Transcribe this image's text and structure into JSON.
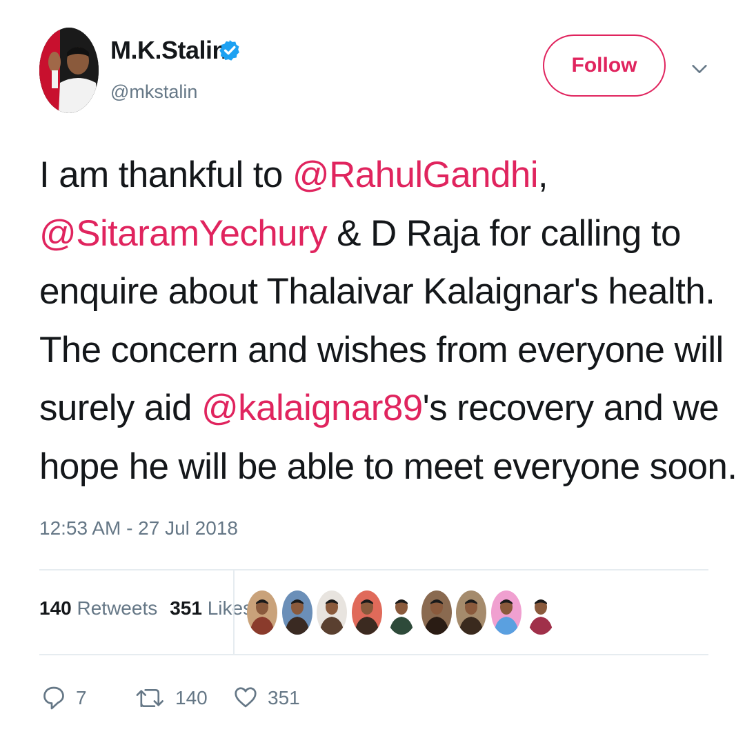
{
  "user": {
    "display_name": "M.K.Stalin",
    "handle": "@mkstalin",
    "verified": true
  },
  "follow_label": "Follow",
  "tweet": {
    "lines": [
      [
        {
          "t": "I am thankful to "
        },
        {
          "t": "@RahulGandhi",
          "mention": true
        },
        {
          "t": ","
        }
      ],
      [
        {
          "t": "@SitaramYechury",
          "mention": true
        },
        {
          "t": " & D Raja for calling to"
        }
      ],
      [
        {
          "t": "enquire about Thalaivar Kalaignar's health."
        }
      ],
      [
        {
          "t": "The concern and wishes from everyone will"
        }
      ],
      [
        {
          "t": "surely aid "
        },
        {
          "t": "@kalaignar89",
          "mention": true
        },
        {
          "t": "'s recovery and we"
        }
      ],
      [
        {
          "t": "hope he will be able to meet everyone soon."
        }
      ]
    ],
    "timestamp": "12:53 AM - 27 Jul 2018"
  },
  "stats": {
    "retweets_count": "140",
    "retweets_label": "Retweets",
    "likes_count": "351",
    "likes_label": "Likes"
  },
  "liker_avatars": [
    {
      "name": "liker-avatar-1",
      "bg": "#c9a27a",
      "fg": "#8a3b2c"
    },
    {
      "name": "liker-avatar-2",
      "bg": "#6b8fb8",
      "fg": "#3a2a22"
    },
    {
      "name": "liker-avatar-3",
      "bg": "#e8e4df",
      "fg": "#5a4030"
    },
    {
      "name": "liker-avatar-4",
      "bg": "#e06a5a",
      "fg": "#3b2a20"
    },
    {
      "name": "liker-avatar-5",
      "bg": "#ffffff",
      "fg": "#2e4a3a"
    },
    {
      "name": "liker-avatar-6",
      "bg": "#8a6a50",
      "fg": "#2a1c14"
    },
    {
      "name": "liker-avatar-7",
      "bg": "#a58b6c",
      "fg": "#3a2a1e"
    },
    {
      "name": "liker-avatar-8",
      "bg": "#f0a0d0",
      "fg": "#5aa0e0"
    },
    {
      "name": "liker-avatar-9",
      "bg": "#ffffff",
      "fg": "#a0304a"
    }
  ],
  "actions": {
    "reply_count": "7",
    "retweet_count": "140",
    "like_count": "351"
  },
  "colors": {
    "accent": "#e0245e",
    "verified": "#1da1f2",
    "muted": "#657786",
    "text": "#14171a"
  }
}
